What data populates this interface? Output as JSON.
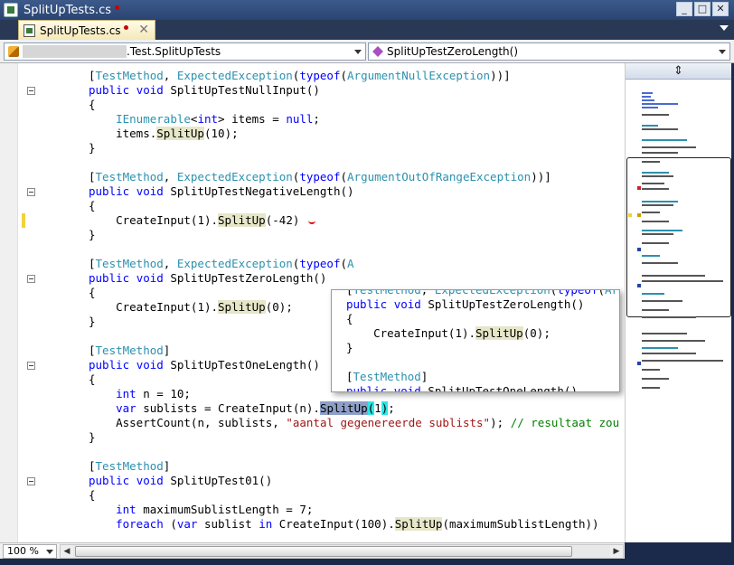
{
  "window": {
    "title": "SplitUpTests.cs",
    "buttons": [
      "_",
      "□",
      "✕"
    ]
  },
  "tab": {
    "label": "SplitUpTests.cs",
    "close": "✕"
  },
  "nav": {
    "class_combo": ".Test.SplitUpTests",
    "member_combo": "SplitUpTestZeroLength()"
  },
  "editor": {
    "lines": [
      "",
      "[TestMethod, ExpectedException(typeof(ArgumentNullException))]",
      "public void SplitUpTestNullInput()",
      "{",
      "    IEnumerable<int> items = null;",
      "    items.SplitUp(10);",
      "}",
      "",
      "[TestMethod, ExpectedException(typeof(ArgumentOutOfRangeException))]",
      "public void SplitUpTestNegativeLength()",
      "{",
      "    CreateInput(1).SplitUp(-42)",
      "}",
      "",
      "[TestMethod, ExpectedException(typeof(A",
      "public void SplitUpTestZeroLength()",
      "{",
      "    CreateInput(1).SplitUp(0);",
      "}",
      "",
      "[TestMethod]",
      "public void SplitUpTestOneLength()",
      "{",
      "    int n = 10;",
      "    var sublists = CreateInput(n).SplitUp(1);",
      "    AssertCount(n, sublists, \"aantal gegenereerde sublists\"); // resultaat zou precie",
      "}",
      "",
      "[TestMethod]",
      "public void SplitUpTest01()",
      "{",
      "    int maximumSublistLength = 7;",
      "    foreach (var sublist in CreateInput(100).SplitUp(maximumSublistLength))"
    ]
  },
  "peek": {
    "lines": [
      "[TestMethod, ExpectedException(typeof(ArgumentOutOfRangeException))]",
      "public void SplitUpTestZeroLength()",
      "{",
      "    CreateInput(1).SplitUp(0);",
      "}",
      "",
      "[TestMethod]",
      "public void SplitUpTestOneLength()"
    ]
  },
  "status": {
    "zoom": "100 %"
  },
  "colors": {
    "keyword": "#0000ff",
    "type": "#2b91af",
    "string": "#a31515",
    "comment": "#008000"
  }
}
